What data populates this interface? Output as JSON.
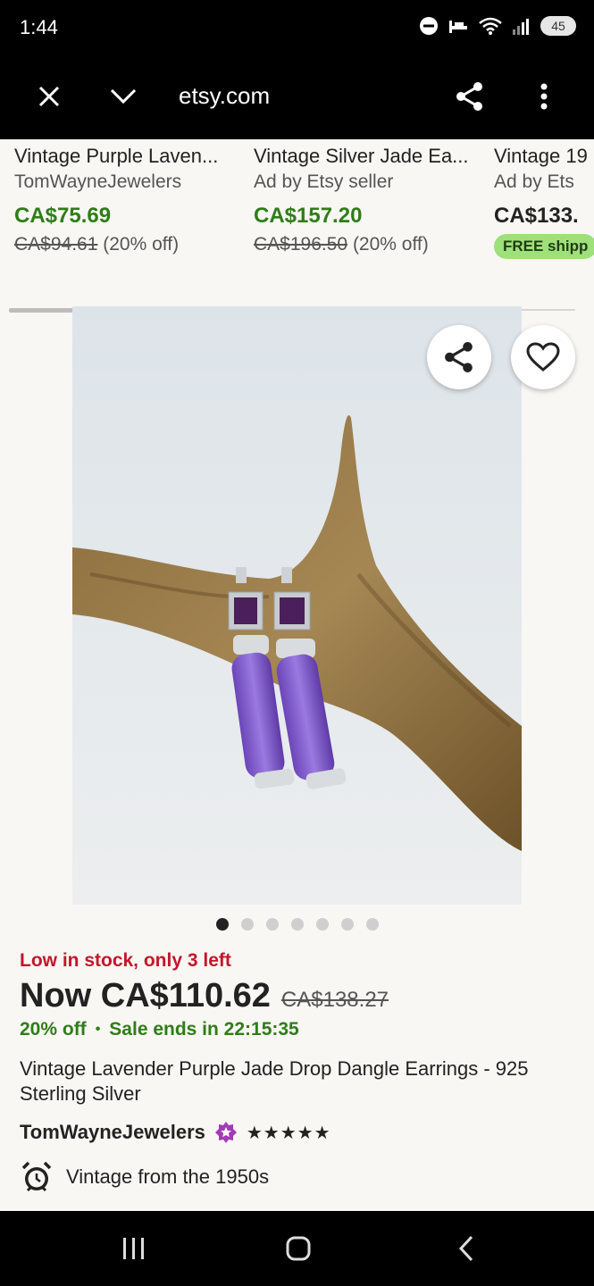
{
  "status": {
    "time": "1:44",
    "battery": "45"
  },
  "browser": {
    "url": "etsy.com"
  },
  "recommendations": [
    {
      "title": "Vintage Purple Laven...",
      "seller": "TomWayneJewelers",
      "price": "CA$75.69",
      "original": "CA$94.61",
      "discount": "(20% off)"
    },
    {
      "title": "Vintage Silver Jade Ea...",
      "seller": "Ad by Etsy seller",
      "price": "CA$157.20",
      "original": "CA$196.50",
      "discount": "(20% off)"
    },
    {
      "title": "Vintage 19",
      "seller": "Ad by Ets",
      "price": "CA$133.",
      "badge": "FREE shipp"
    }
  ],
  "gallery": {
    "dot_count": 7,
    "active_index": 0
  },
  "listing": {
    "stock": "Low in stock, only 3 left",
    "now_price": "Now CA$110.62",
    "was_price": "CA$138.27",
    "discount": "20% off",
    "bullet": "•",
    "sale_ends": "Sale ends in 22:15:35",
    "title": "Vintage Lavender Purple Jade Drop Dangle Earrings - 925 Sterling Silver",
    "shop": "TomWayneJewelers",
    "rating_stars": "★★★★★",
    "rating": 5,
    "vintage": "Vintage from the 1950s"
  },
  "colors": {
    "sale_green": "#2f7d17",
    "stock_red": "#c4162a",
    "star_seller_purple": "#a23bb5",
    "free_ship_green": "#9ee07a"
  }
}
